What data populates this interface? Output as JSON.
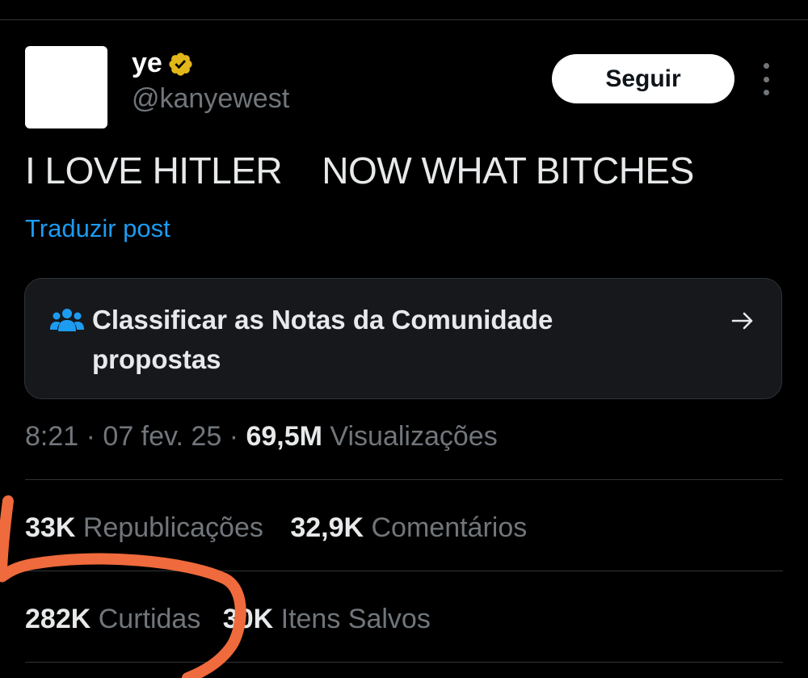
{
  "author": {
    "display_name": "ye",
    "handle": "@kanyewest"
  },
  "follow_button_label": "Seguir",
  "post": {
    "text": "I LOVE HITLER    NOW WHAT BITCHES",
    "translate_label": "Traduzir post"
  },
  "community_notes": {
    "label": "Classificar as Notas da Comunidade propostas"
  },
  "meta": {
    "time": "8:21",
    "separator": "·",
    "date": "07 fev. 25",
    "views_count": "69,5M",
    "views_label": "Visualizações"
  },
  "stats": {
    "reposts_count": "33K",
    "reposts_label": "Republicações",
    "quotes_count": "32,9K",
    "quotes_label": "Comentários",
    "likes_count": "282K",
    "likes_label": "Curtidas",
    "bookmarks_count": "30K",
    "bookmarks_label": "Itens Salvos"
  },
  "colors": {
    "background": "#000000",
    "text_primary": "#e7e9ea",
    "text_secondary": "#71767b",
    "link_blue": "#1d9bf0",
    "verified_gold": "#e2b719",
    "annotation_orange": "#ef6a3c"
  },
  "icons": [
    "verified-badge-icon",
    "more-options-icon",
    "community-notes-people-icon",
    "arrow-right-icon"
  ]
}
